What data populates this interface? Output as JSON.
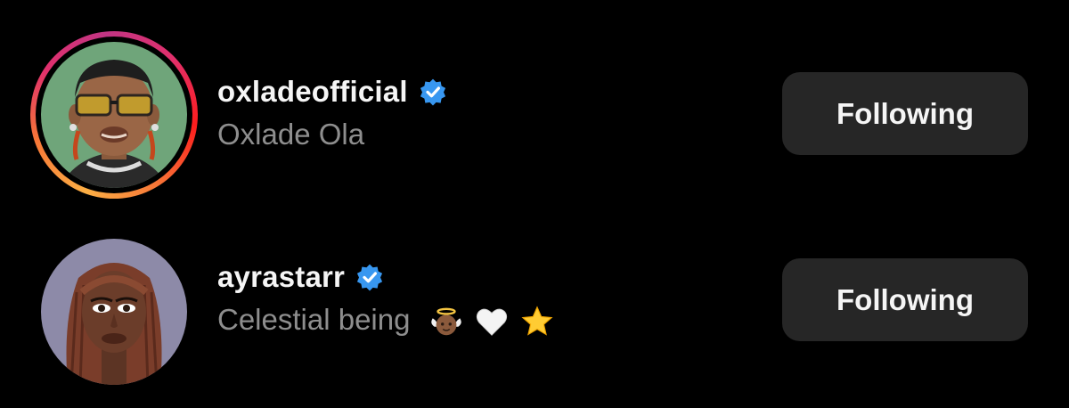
{
  "accounts": [
    {
      "username": "oxladeofficial",
      "full_name": "Oxlade Ola",
      "verified": true,
      "has_story_ring": true,
      "button_label": "Following",
      "avatar_icon": "cartoon-avatar-sunglasses"
    },
    {
      "username": "ayrastarr",
      "full_name": "Celestial being",
      "emojis": [
        "baby-angel-emoji",
        "white-heart-emoji",
        "star-emoji"
      ],
      "verified": true,
      "has_story_ring": false,
      "button_label": "Following",
      "avatar_icon": "cartoon-avatar-braids"
    }
  ],
  "colors": {
    "background": "#000000",
    "button_bg": "#262626",
    "secondary_text": "#8e8e8e",
    "verified_blue": "#3897f0"
  }
}
